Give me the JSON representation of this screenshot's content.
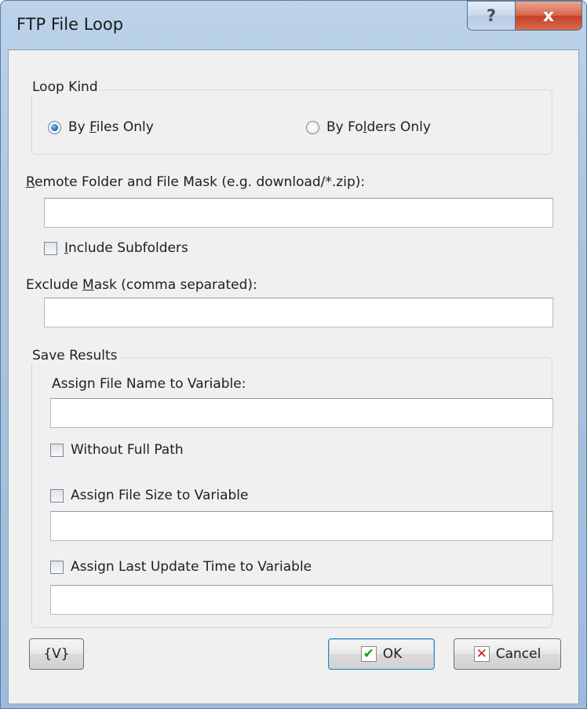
{
  "window": {
    "title": "FTP File Loop",
    "help_label": "?",
    "close_label": "x"
  },
  "loop_kind": {
    "legend": "Loop Kind",
    "by_files": {
      "pre": "By ",
      "ul": "F",
      "post": "iles Only",
      "selected": true
    },
    "by_folders": {
      "pre": "By Fo",
      "ul": "l",
      "post": "ders Only",
      "selected": false
    }
  },
  "remote_folder": {
    "label_ul": "R",
    "label_rest": "emote Folder and File Mask (e.g. download/*.zip):",
    "value": ""
  },
  "include_subfolders": {
    "ul": "I",
    "rest": "nclude Subfolders",
    "checked": false
  },
  "exclude_mask": {
    "label_pre": "Exclude ",
    "label_ul": "M",
    "label_post": "ask (comma separated):",
    "value": ""
  },
  "save_results": {
    "legend": "Save Results",
    "assign_file_name_label": "Assign File Name to Variable:",
    "assign_file_name_value": "",
    "without_full_path": {
      "label": "Without Full Path",
      "checked": false
    },
    "assign_file_size": {
      "label": "Assign File Size to Variable",
      "checked": false,
      "value": ""
    },
    "assign_last_update": {
      "label": "Assign Last Update Time to Variable",
      "checked": false,
      "value": ""
    }
  },
  "buttons": {
    "variables": "{V}",
    "ok": "OK",
    "cancel": "Cancel",
    "ok_icon": "✔",
    "cancel_icon": "✕"
  }
}
